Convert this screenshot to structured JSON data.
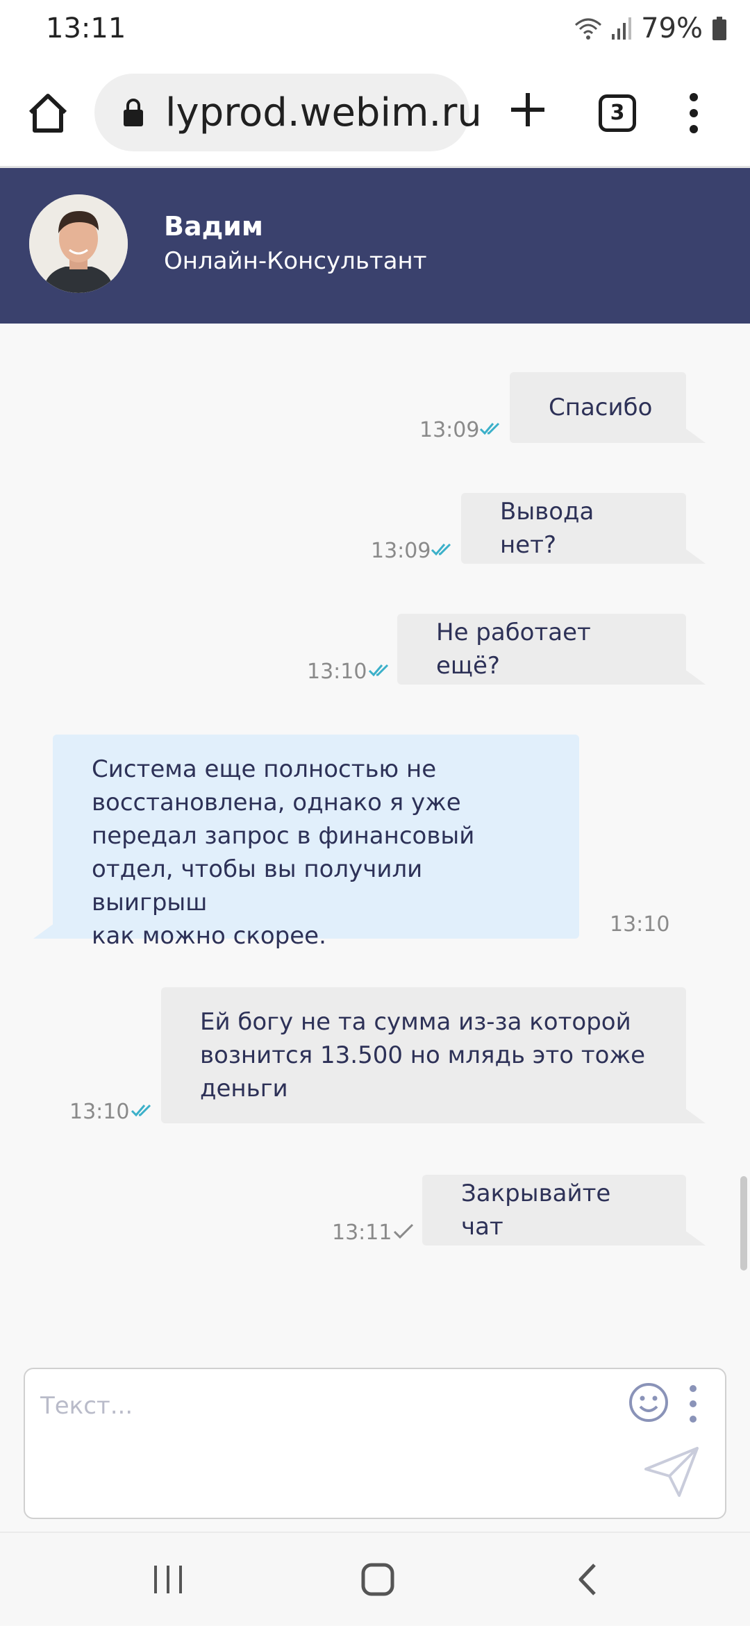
{
  "status_bar": {
    "time": "13:11",
    "battery": "79%"
  },
  "browser": {
    "url": "lyprod.webim.ru",
    "tab_count": "3"
  },
  "chat_header": {
    "agent_name": "Вадим",
    "agent_role": "Онлайн-Консультант"
  },
  "messages": [
    {
      "direction": "outgoing",
      "lines": [
        "Спасибо"
      ],
      "time": "13:09",
      "status": "read"
    },
    {
      "direction": "outgoing",
      "lines": [
        "Вывода нет?"
      ],
      "time": "13:09",
      "status": "read"
    },
    {
      "direction": "outgoing",
      "lines": [
        "Не работает ещё?"
      ],
      "time": "13:10",
      "status": "read"
    },
    {
      "direction": "incoming",
      "lines": [
        "Система еще полностью не",
        "восстановлена, однако я уже",
        "передал запрос в финансовый",
        "отдел, чтобы вы получили выигрыш",
        "как можно скорее."
      ],
      "time": "13:10"
    },
    {
      "direction": "outgoing",
      "lines": [
        "Ей богу не та сумма из-за которой",
        "вознится 13.500 но млядь это тоже",
        "деньги"
      ],
      "time": "13:10",
      "status": "read"
    },
    {
      "direction": "outgoing",
      "lines": [
        "Закрывайте чат"
      ],
      "time": "13:11",
      "status": "sent"
    }
  ],
  "composer": {
    "placeholder": "Текст..."
  },
  "colors": {
    "header_bg": "#3a416d",
    "outgoing_bubble": "#ececec",
    "incoming_bubble": "#e1effb",
    "read_tick": "#3bb0c9",
    "sent_tick": "#8a8a8a"
  },
  "icons": {
    "home": "home-icon",
    "lock": "lock-icon",
    "new_tab": "plus-icon",
    "tabs": "tabs-icon",
    "menu": "kebab-menu-icon",
    "emoji": "emoji-icon",
    "more": "more-vertical-icon",
    "send": "send-icon",
    "recents": "recents-icon",
    "nav_home": "nav-home-icon",
    "back": "back-icon"
  }
}
